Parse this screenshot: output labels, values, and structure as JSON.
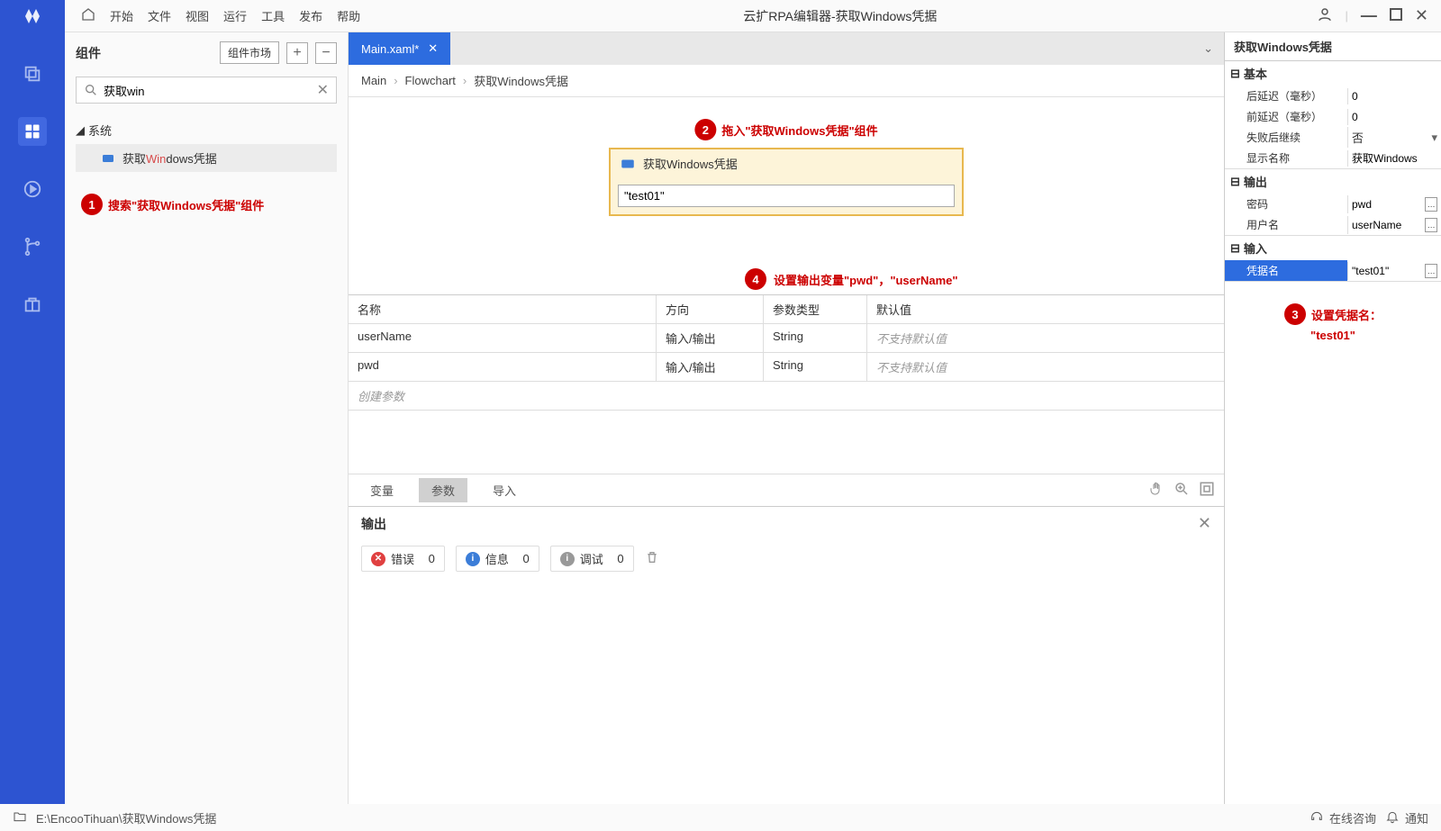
{
  "title": "云扩RPA编辑器-获取Windows凭据",
  "menu": [
    "开始",
    "文件",
    "视图",
    "运行",
    "工具",
    "发布",
    "帮助"
  ],
  "componentsPanel": {
    "title": "组件",
    "market": "组件市场",
    "searchValue": "获取win",
    "treeParent": "系统",
    "treeItemPrefix": "获取",
    "treeItemHighlight": "Win",
    "treeItemSuffix": "dows凭据"
  },
  "annotations": {
    "a1": "搜索\"获取Windows凭据\"组件",
    "a2": "拖入\"获取Windows凭据\"组件",
    "a3_line1": "设置凭据名：",
    "a3_line2": "\"test01\"",
    "a4": "设置输出变量\"pwd\"，\"userName\""
  },
  "tab": {
    "label": "Main.xaml*"
  },
  "breadcrumb": [
    "Main",
    "Flowchart",
    "获取Windows凭据"
  ],
  "activity": {
    "title": "获取Windows凭据",
    "value": "\"test01\""
  },
  "paramsTable": {
    "headers": [
      "名称",
      "方向",
      "参数类型",
      "默认值"
    ],
    "rows": [
      {
        "name": "userName",
        "dir": "输入/输出",
        "type": "String",
        "def": "不支持默认值"
      },
      {
        "name": "pwd",
        "dir": "输入/输出",
        "type": "String",
        "def": "不支持默认值"
      }
    ],
    "create": "创建参数",
    "tabs": [
      "变量",
      "参数",
      "导入"
    ]
  },
  "output": {
    "title": "输出",
    "error": "错误",
    "errorCount": "0",
    "info": "信息",
    "infoCount": "0",
    "debug": "调试",
    "debugCount": "0"
  },
  "props": {
    "title": "获取Windows凭据",
    "basic": {
      "label": "基本",
      "postDelay": {
        "label": "后延迟（毫秒）",
        "value": "0"
      },
      "preDelay": {
        "label": "前延迟（毫秒）",
        "value": "0"
      },
      "continueOnFail": {
        "label": "失败后继续",
        "value": "否"
      },
      "displayName": {
        "label": "显示名称",
        "value": "获取Windows"
      }
    },
    "output": {
      "label": "输出",
      "password": {
        "label": "密码",
        "value": "pwd"
      },
      "username": {
        "label": "用户名",
        "value": "userName"
      }
    },
    "input": {
      "label": "输入",
      "credName": {
        "label": "凭据名",
        "value": "\"test01\""
      }
    }
  },
  "statusbar": {
    "path": "E:\\EncooTihuan\\获取Windows凭据",
    "consult": "在线咨询",
    "notify": "通知"
  }
}
